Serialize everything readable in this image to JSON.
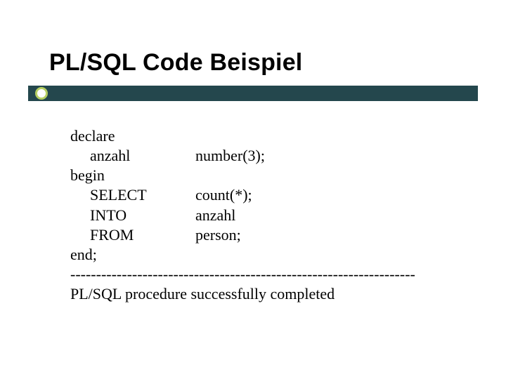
{
  "title": "PL/SQL Code Beispiel",
  "code": {
    "l1": "declare",
    "l2a": "anzahl",
    "l2b": "number(3);",
    "l3": "begin",
    "l4a": "SELECT",
    "l4b": "count(*);",
    "l5a": "INTO",
    "l5b": "anzahl",
    "l6a": "FROM",
    "l6b": "person;",
    "l7": "end;",
    "separator": "-------------------------------------------------------------------",
    "result": "PL/SQL procedure successfully completed"
  }
}
